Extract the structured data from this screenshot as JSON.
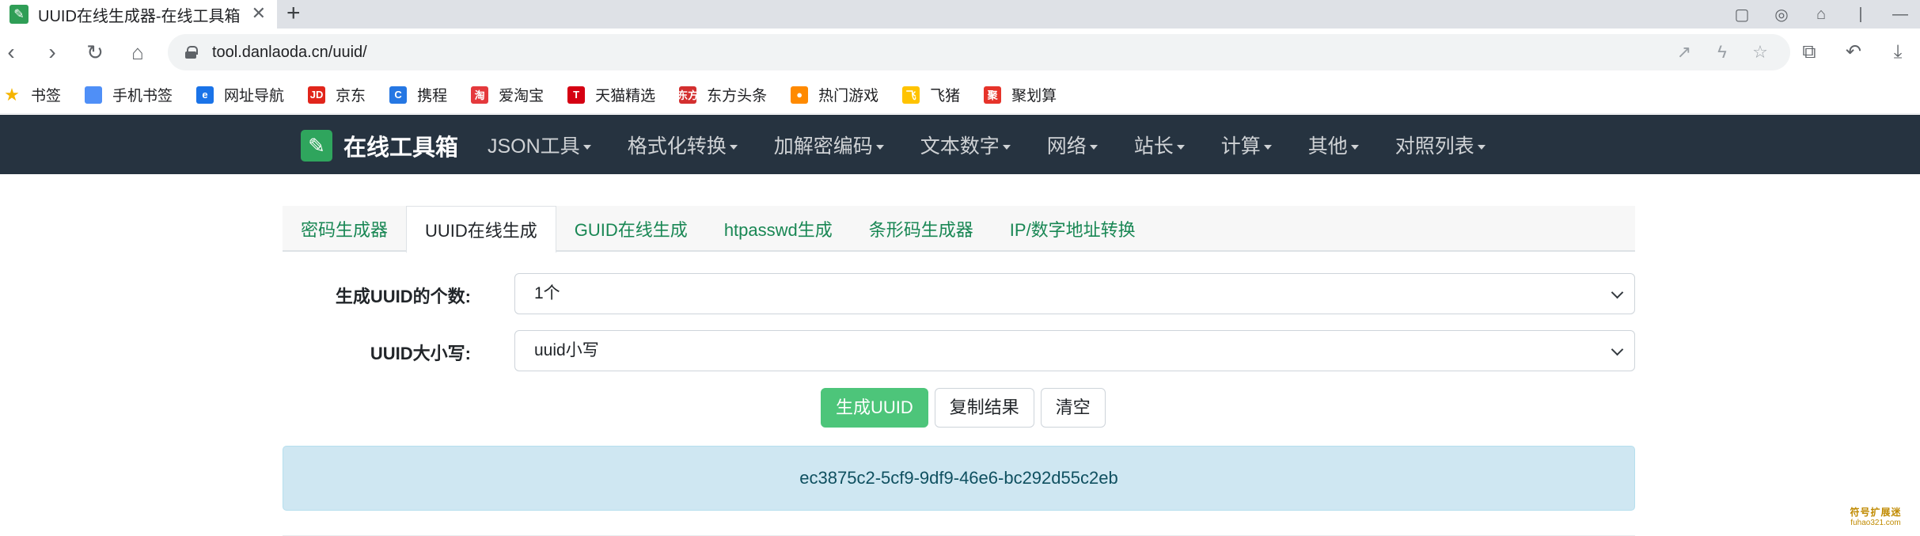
{
  "browser": {
    "tab_title": "UUID在线生成器-在线工具箱",
    "tab_close": "✕",
    "new_tab": "+",
    "url": "tool.danlaoda.cn/uuid/"
  },
  "bookmarks": [
    {
      "label": "书签",
      "icon": "star-icon",
      "color": "#f5b400",
      "glyph": "★"
    },
    {
      "label": "手机书签",
      "icon": "phone-bookmark-icon",
      "color": "#4f8ff7",
      "glyph": ""
    },
    {
      "label": "网址导航",
      "icon": "navigation-icon",
      "color": "#1a73e8",
      "glyph": "e"
    },
    {
      "label": "京东",
      "icon": "jd-icon",
      "color": "#e1251b",
      "glyph": "JD"
    },
    {
      "label": "携程",
      "icon": "ctrip-icon",
      "color": "#2577e3",
      "glyph": "C"
    },
    {
      "label": "爱淘宝",
      "icon": "aitaobao-icon",
      "color": "#e4393c",
      "glyph": "淘"
    },
    {
      "label": "天猫精选",
      "icon": "tmall-icon",
      "color": "#d50012",
      "glyph": "T"
    },
    {
      "label": "东方头条",
      "icon": "eastday-icon",
      "color": "#d32f2f",
      "glyph": "东方"
    },
    {
      "label": "热门游戏",
      "icon": "games-icon",
      "color": "#ff8a00",
      "glyph": "●"
    },
    {
      "label": "飞猪",
      "icon": "fliggy-icon",
      "color": "#ffc300",
      "glyph": "飞"
    },
    {
      "label": "聚划算",
      "icon": "juhuasuan-icon",
      "color": "#e6332a",
      "glyph": "聚"
    }
  ],
  "site": {
    "brand": "在线工具箱",
    "menu": [
      "JSON工具",
      "格式化转换",
      "加解密编码",
      "文本数字",
      "网络",
      "站长",
      "计算",
      "其他",
      "对照列表"
    ]
  },
  "tabs": [
    "密码生成器",
    "UUID在线生成",
    "GUID在线生成",
    "htpasswd生成",
    "条形码生成器",
    "IP/数字地址转换"
  ],
  "active_tab": 1,
  "form": {
    "count_label": "生成UUID的个数:",
    "count_value": "1个",
    "case_label": "UUID大小写:",
    "case_value": "uuid小写"
  },
  "buttons": {
    "generate": "生成UUID",
    "copy": "复制结果",
    "clear": "清空"
  },
  "result": "ec3875c2-5cf9-9df9-46e6-bc292d55c2eb",
  "watermark": {
    "line1": "符号扩展迷",
    "line2": "fuhao321.com"
  },
  "colors": {
    "navbar": "#263340",
    "brand_green": "#2fa55d",
    "primary_button": "#4dc57a",
    "result_bg": "#cfe7f2",
    "tab_link": "#198754"
  }
}
